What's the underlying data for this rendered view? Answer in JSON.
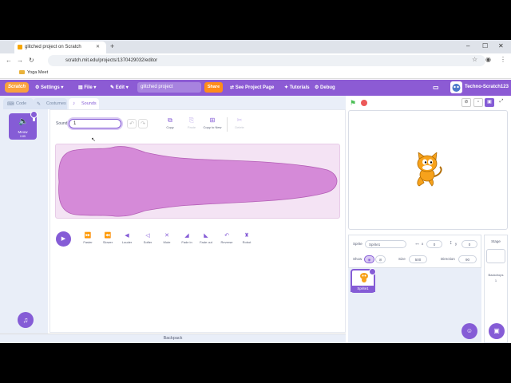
{
  "browser": {
    "tab_title": "glitched project on Scratch",
    "url": "scratch.mit.edu/projects/1370429032/editor",
    "bookmark": "Yoga Meet"
  },
  "menubar": {
    "logo": "Scratch",
    "settings": "Settings",
    "file": "File",
    "edit": "Edit",
    "project_title": "glitched project",
    "share": "Share",
    "see_project_page": "See Project Page",
    "tutorials": "Tutorials",
    "debug": "Debug",
    "username": "Techno-Scratch123"
  },
  "editor_tabs": [
    "Code",
    "Costumes",
    "Sounds"
  ],
  "sound_list": [
    {
      "name": "Meow",
      "duration": "0.85"
    }
  ],
  "sound_editor": {
    "sound_label": "Sound",
    "sound_name": "1",
    "tools": [
      "Copy",
      "Paste",
      "Copy to New",
      "Delete"
    ],
    "effects": [
      "Faster",
      "Slower",
      "Louder",
      "Softer",
      "Mute",
      "Fade in",
      "Fade out",
      "Reverse",
      "Robot"
    ],
    "waveform_color": "#d58ad8",
    "waveform_bg": "#f4e3f4"
  },
  "backpack": "Backpack",
  "sprite_info": {
    "sprite_label": "Sprite",
    "sprite_name": "Sprite1",
    "x_label": "x",
    "x_value": "0",
    "y_label": "y",
    "y_value": "0",
    "show_label": "Show",
    "size_label": "Size",
    "size_value": "500",
    "direction_label": "Direction",
    "direction_value": "90"
  },
  "sprites": [
    {
      "name": "Sprite1"
    }
  ],
  "stage_pane": {
    "title": "Stage",
    "backdrops_label": "Backdrops",
    "backdrops_count": "1"
  },
  "colors": {
    "accent": "#855cd6",
    "menubar": "#8c5bd4",
    "share": "#ff8c1a",
    "flag": "#4cbf56",
    "stop": "#ec5959"
  }
}
